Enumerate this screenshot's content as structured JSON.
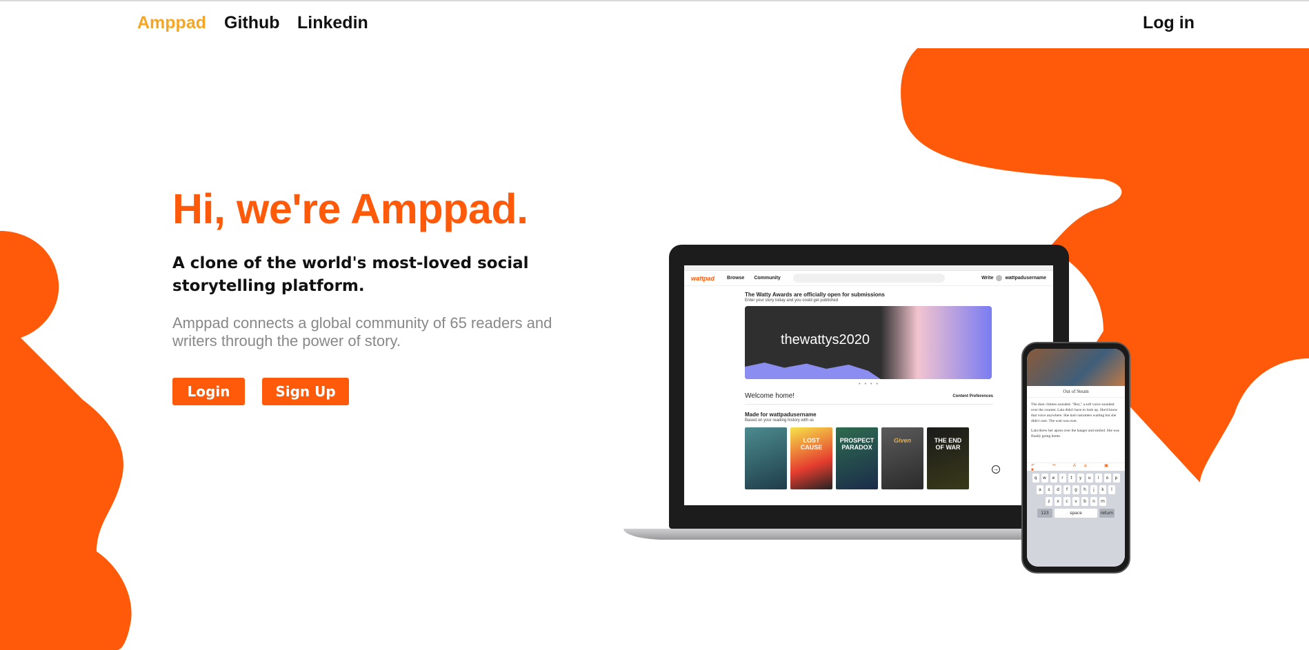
{
  "nav": {
    "brand": "Amppad",
    "github": "Github",
    "linkedin": "Linkedin",
    "login": "Log in"
  },
  "hero": {
    "title": "Hi, we're Amppad.",
    "subtitle": "A clone of the world's most-loved social storytelling platform.",
    "description": "Amppad connects a global community of 65 readers and writers through the power of story.",
    "login_button": "Login",
    "signup_button": "Sign Up"
  },
  "colors": {
    "accent": "#ff5a0a",
    "brand": "#f5a623"
  },
  "laptop_screen": {
    "logo": "wattpad",
    "nav_browse": "Browse",
    "nav_community": "Community",
    "write": "Write",
    "username": "wattpadusername",
    "banner_heading": "The Watty Awards are officially open for submissions",
    "banner_sub": "Enter your story today and you could get published",
    "banner_text": "thewattys2020",
    "carousel_dots": "• • • •",
    "welcome": "Welcome home!",
    "content_prefs": "Content Preferences",
    "made_for": "Made for wattpadusername",
    "made_for_sub": "Based on your reading history with us",
    "books": [
      "",
      "LOST CAUSE",
      "PROSPECT PARADOX",
      "Given",
      "THE END OF WAR"
    ],
    "next": "→"
  },
  "phone_screen": {
    "story_title": "Out of Steam",
    "paragraph1": "The door chimes sounded. \"Hey,\" a soft voice sounded over the counter. Lala didn't have to look up. She'd know that voice anywhere. She had customers waiting but she didn't care. The wait was over.",
    "paragraph2": "Lala threw her apron over the hanger and smiled. She was finally going home.",
    "keyboard_row1": [
      "q",
      "w",
      "e",
      "r",
      "t",
      "y",
      "u",
      "i",
      "o",
      "p"
    ],
    "keyboard_row2": [
      "a",
      "s",
      "d",
      "f",
      "g",
      "h",
      "j",
      "k",
      "l"
    ],
    "keyboard_row3": [
      "z",
      "x",
      "c",
      "v",
      "b",
      "n",
      "m"
    ],
    "key_123": "123",
    "key_space": "space",
    "key_return": "return"
  }
}
